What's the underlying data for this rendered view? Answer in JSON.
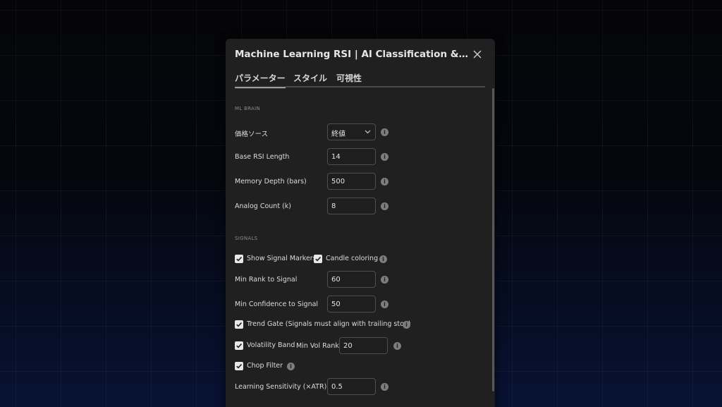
{
  "dialog": {
    "title": "Machine Learning RSI | AI Classification & Ranking",
    "tabs": [
      {
        "label": "パラメーター",
        "active": true
      },
      {
        "label": "スタイル",
        "active": false
      },
      {
        "label": "可視性",
        "active": false
      }
    ]
  },
  "ml_brain": {
    "section_title": "ML BRAIN",
    "price_source": {
      "label": "価格ソース",
      "value": "終値"
    },
    "base_rsi_length": {
      "label": "Base RSI Length",
      "value": "14"
    },
    "memory_depth": {
      "label": "Memory Depth (bars)",
      "value": "500"
    },
    "analog_count": {
      "label": "Analog Count (k)",
      "value": "8"
    }
  },
  "signals": {
    "section_title": "SIGNALS",
    "show_signal_markers": {
      "label": "Show Signal Markers",
      "checked": true
    },
    "candle_coloring": {
      "label": "Candle coloring",
      "checked": true
    },
    "min_rank": {
      "label": "Min Rank to Signal",
      "value": "60"
    },
    "min_confidence": {
      "label": "Min Confidence to Signal",
      "value": "50"
    },
    "trend_gate": {
      "label": "Trend Gate (Signals must align with trailing stop)",
      "checked": true
    },
    "volatility_band": {
      "label": "Volatility Band",
      "checked": true
    },
    "min_vol_rank": {
      "label": "Min Vol Rank",
      "value": "20"
    },
    "chop_filter": {
      "label": "Chop Filter",
      "checked": true
    },
    "learning_sensitivity": {
      "label": "Learning Sensitivity (×ATR)",
      "value": "0.5"
    }
  },
  "icons": {
    "info": "i"
  },
  "colors": {
    "dialog_bg": "#202020",
    "checkbox": "#e8e8e8",
    "input_border": "#4e4e4e"
  }
}
